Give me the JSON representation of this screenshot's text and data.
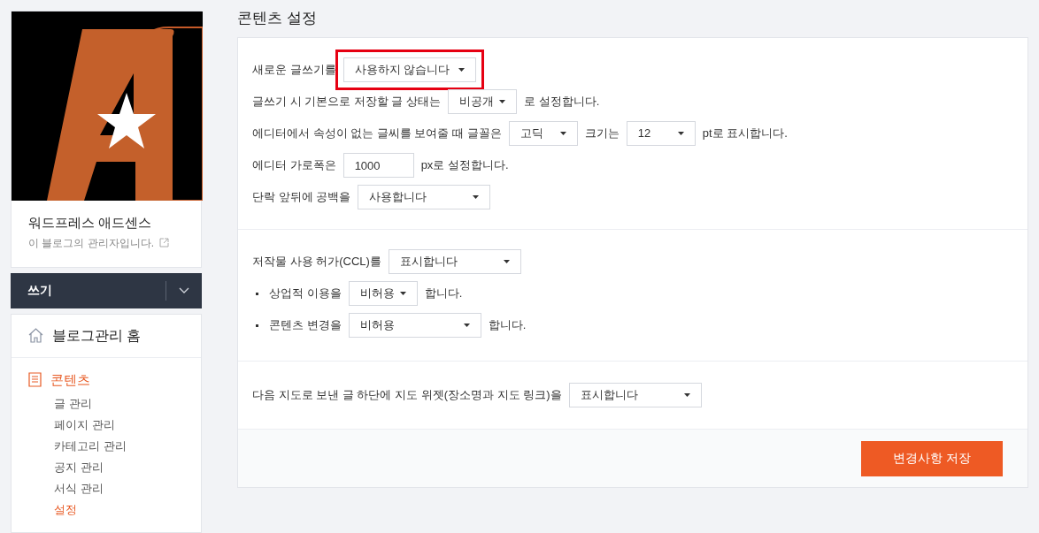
{
  "sidebar": {
    "blog_name": "워드프레스 애드센스",
    "role": "이 블로그의 관리자입니다.",
    "write_button": "쓰기",
    "menu": [
      {
        "kind": "home",
        "label": "블로그관리 홈",
        "selected": false
      },
      {
        "kind": "section",
        "label": "콘텐츠",
        "selected": true,
        "children": [
          {
            "label": "글 관리",
            "selected": false
          },
          {
            "label": "페이지 관리",
            "selected": false
          },
          {
            "label": "카테고리 관리",
            "selected": false
          },
          {
            "label": "공지 관리",
            "selected": false
          },
          {
            "label": "서식 관리",
            "selected": false
          },
          {
            "label": "설정",
            "selected": true
          }
        ]
      }
    ]
  },
  "title": "콘텐츠 설정",
  "sections": [
    {
      "rows": [
        {
          "bullet": false,
          "parts": [
            {
              "kind": "text",
              "text": "새로운 글쓰기를"
            },
            {
              "kind": "select",
              "value": "사용하지 않습니다",
              "highlighted": true
            }
          ]
        },
        {
          "bullet": false,
          "parts": [
            {
              "kind": "text",
              "text": "글쓰기 시 기본으로 저장할 글 상태는"
            },
            {
              "kind": "select",
              "value": "비공개",
              "highlighted": false
            },
            {
              "kind": "text",
              "text": "로 설정합니다."
            }
          ]
        },
        {
          "bullet": false,
          "parts": [
            {
              "kind": "text",
              "text": "에디터에서 속성이 없는 글씨를 보여줄 때 글꼴은"
            },
            {
              "kind": "select",
              "value": "고딕",
              "highlighted": false
            },
            {
              "kind": "text",
              "text": "크기는"
            },
            {
              "kind": "select",
              "value": "12",
              "highlighted": false
            },
            {
              "kind": "text",
              "text": "pt로 표시합니다."
            }
          ]
        },
        {
          "bullet": false,
          "parts": [
            {
              "kind": "text",
              "text": "에디터 가로폭은"
            },
            {
              "kind": "input",
              "value": "1000"
            },
            {
              "kind": "text",
              "text": "px로 설정합니다."
            }
          ]
        },
        {
          "bullet": false,
          "parts": [
            {
              "kind": "text",
              "text": "단락 앞뒤에 공백을"
            },
            {
              "kind": "select",
              "value": "사용합니다",
              "highlighted": false
            }
          ]
        }
      ]
    },
    {
      "rows": [
        {
          "bullet": false,
          "parts": [
            {
              "kind": "text",
              "text": "저작물 사용 허가(CCL)를"
            },
            {
              "kind": "select",
              "value": "표시합니다",
              "highlighted": false
            }
          ]
        },
        {
          "bullet": true,
          "parts": [
            {
              "kind": "text",
              "text": "상업적 이용을"
            },
            {
              "kind": "select",
              "value": "비허용",
              "highlighted": false
            },
            {
              "kind": "text",
              "text": "합니다."
            }
          ]
        },
        {
          "bullet": true,
          "parts": [
            {
              "kind": "text",
              "text": "콘텐츠 변경을"
            },
            {
              "kind": "select",
              "value": "비허용",
              "highlighted": false
            },
            {
              "kind": "text",
              "text": "합니다."
            }
          ]
        }
      ]
    },
    {
      "rows": [
        {
          "bullet": false,
          "parts": [
            {
              "kind": "text",
              "text": "다음 지도로 보낸 글 하단에 지도 위젯(장소명과 지도 링크)을"
            },
            {
              "kind": "select",
              "value": "표시합니다",
              "highlighted": false
            }
          ]
        }
      ]
    }
  ],
  "save_button": "변경사항 저장"
}
